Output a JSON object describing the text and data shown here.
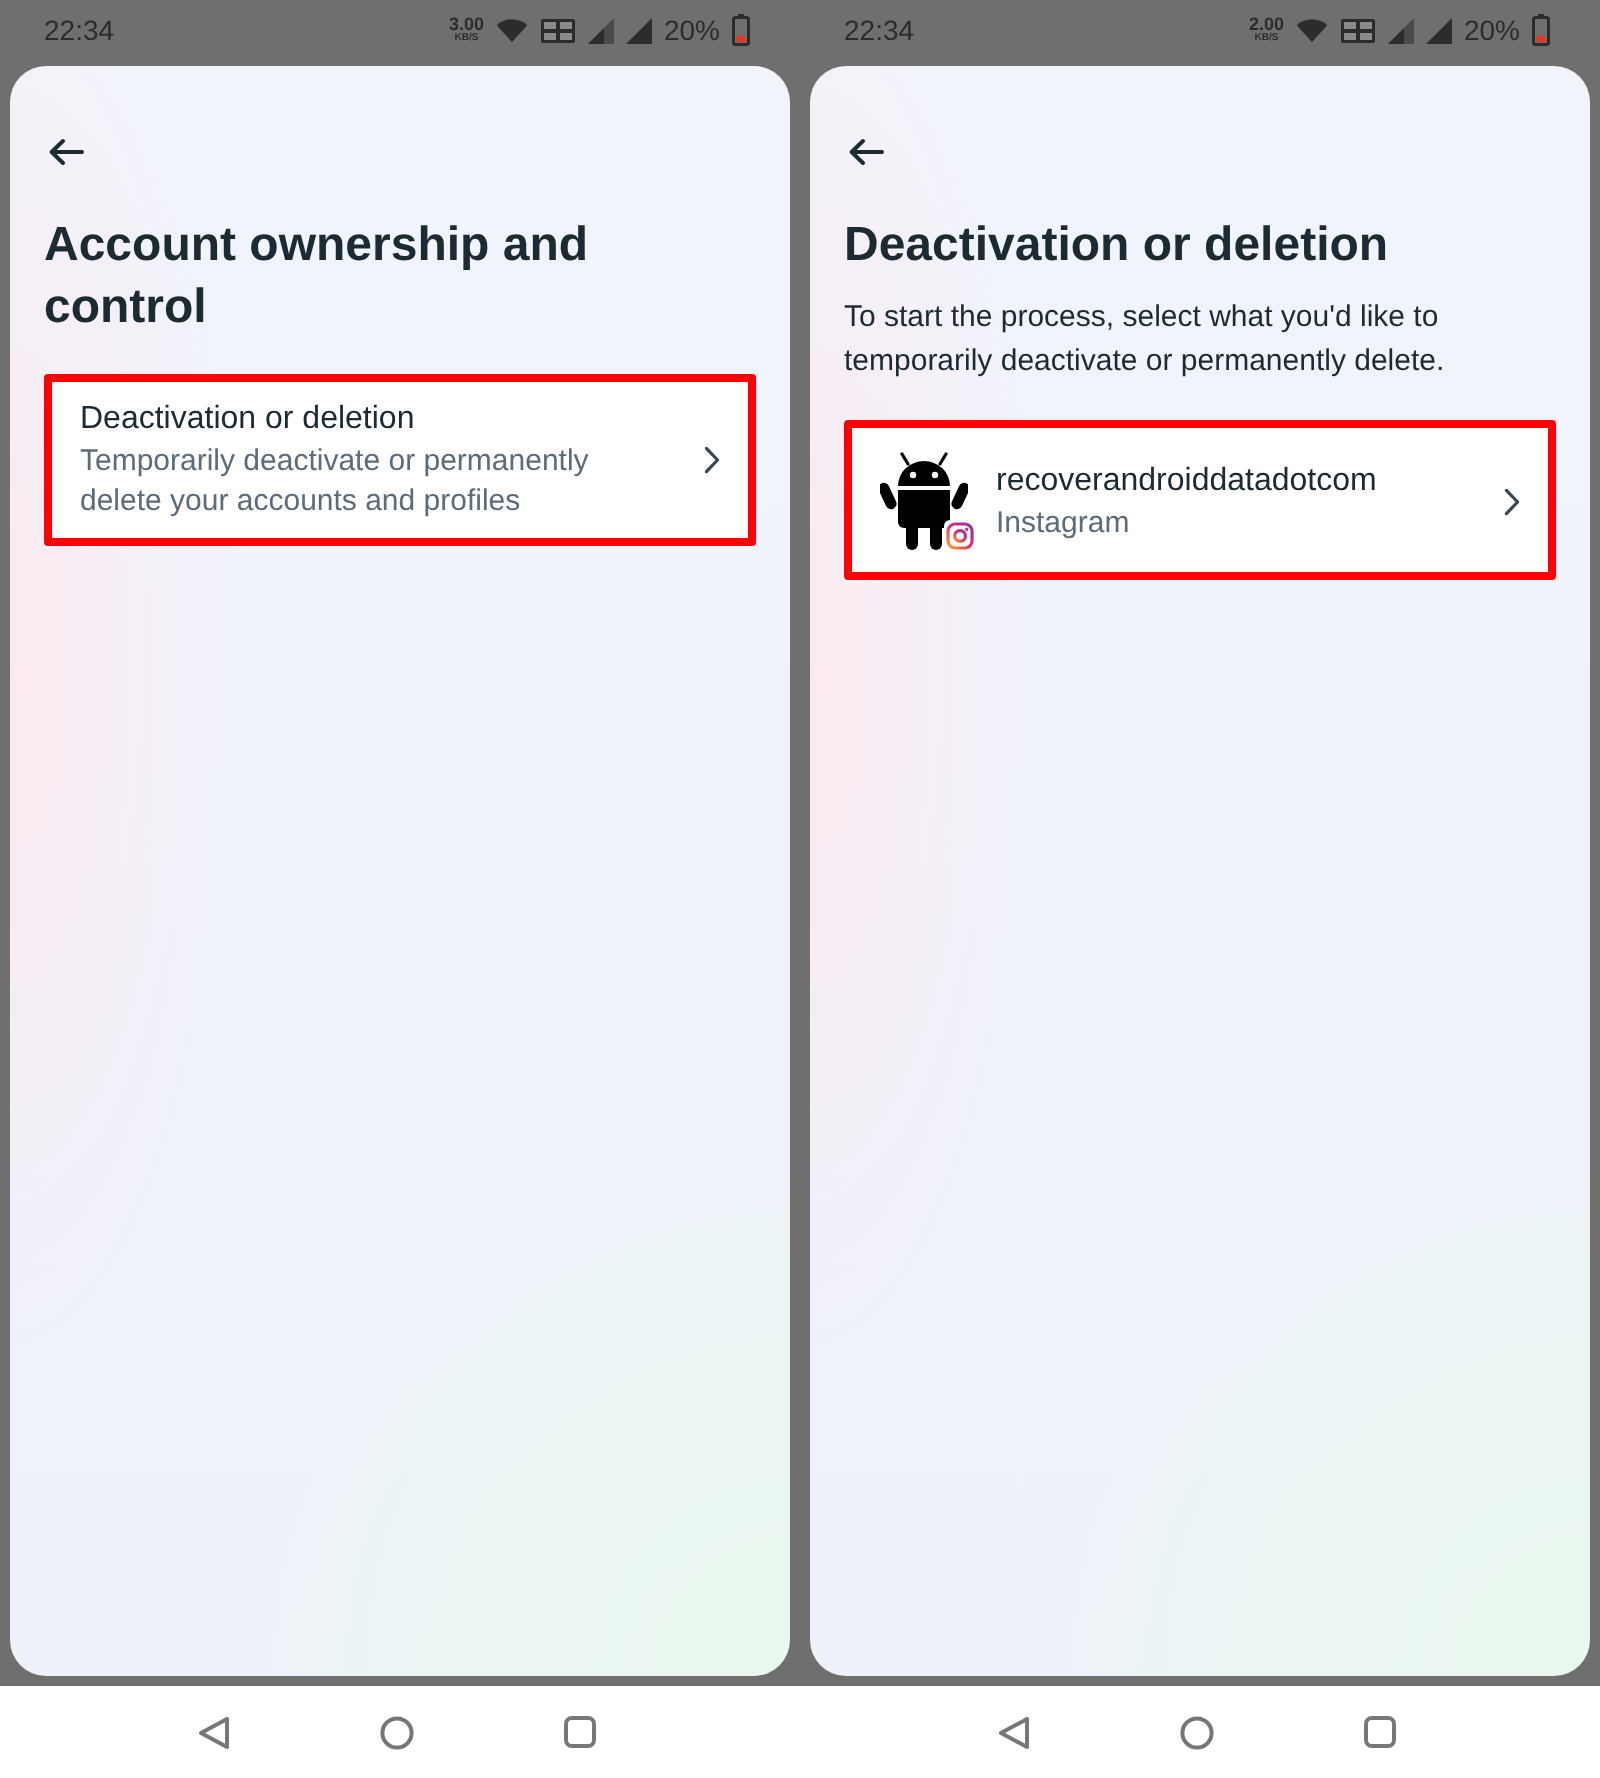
{
  "screens": [
    {
      "status_bar": {
        "time": "22:34",
        "net_speed": "3.00",
        "net_speed_unit": "KB/S",
        "battery": "20%"
      },
      "title": "Account ownership and control",
      "items": [
        {
          "kind": "option",
          "title": "Deactivation or deletion",
          "subtitle": "Temporarily deactivate or permanently delete your accounts and profiles",
          "highlighted": true
        }
      ]
    },
    {
      "status_bar": {
        "time": "22:34",
        "net_speed": "2.00",
        "net_speed_unit": "KB/S",
        "battery": "20%"
      },
      "title": "Deactivation or deletion",
      "description": "To start the process, select what you'd like to temporarily deactivate or permanently delete.",
      "items": [
        {
          "kind": "account",
          "title": "recoverandroiddatadotcom",
          "subtitle": "Instagram",
          "highlighted": true
        }
      ]
    }
  ]
}
